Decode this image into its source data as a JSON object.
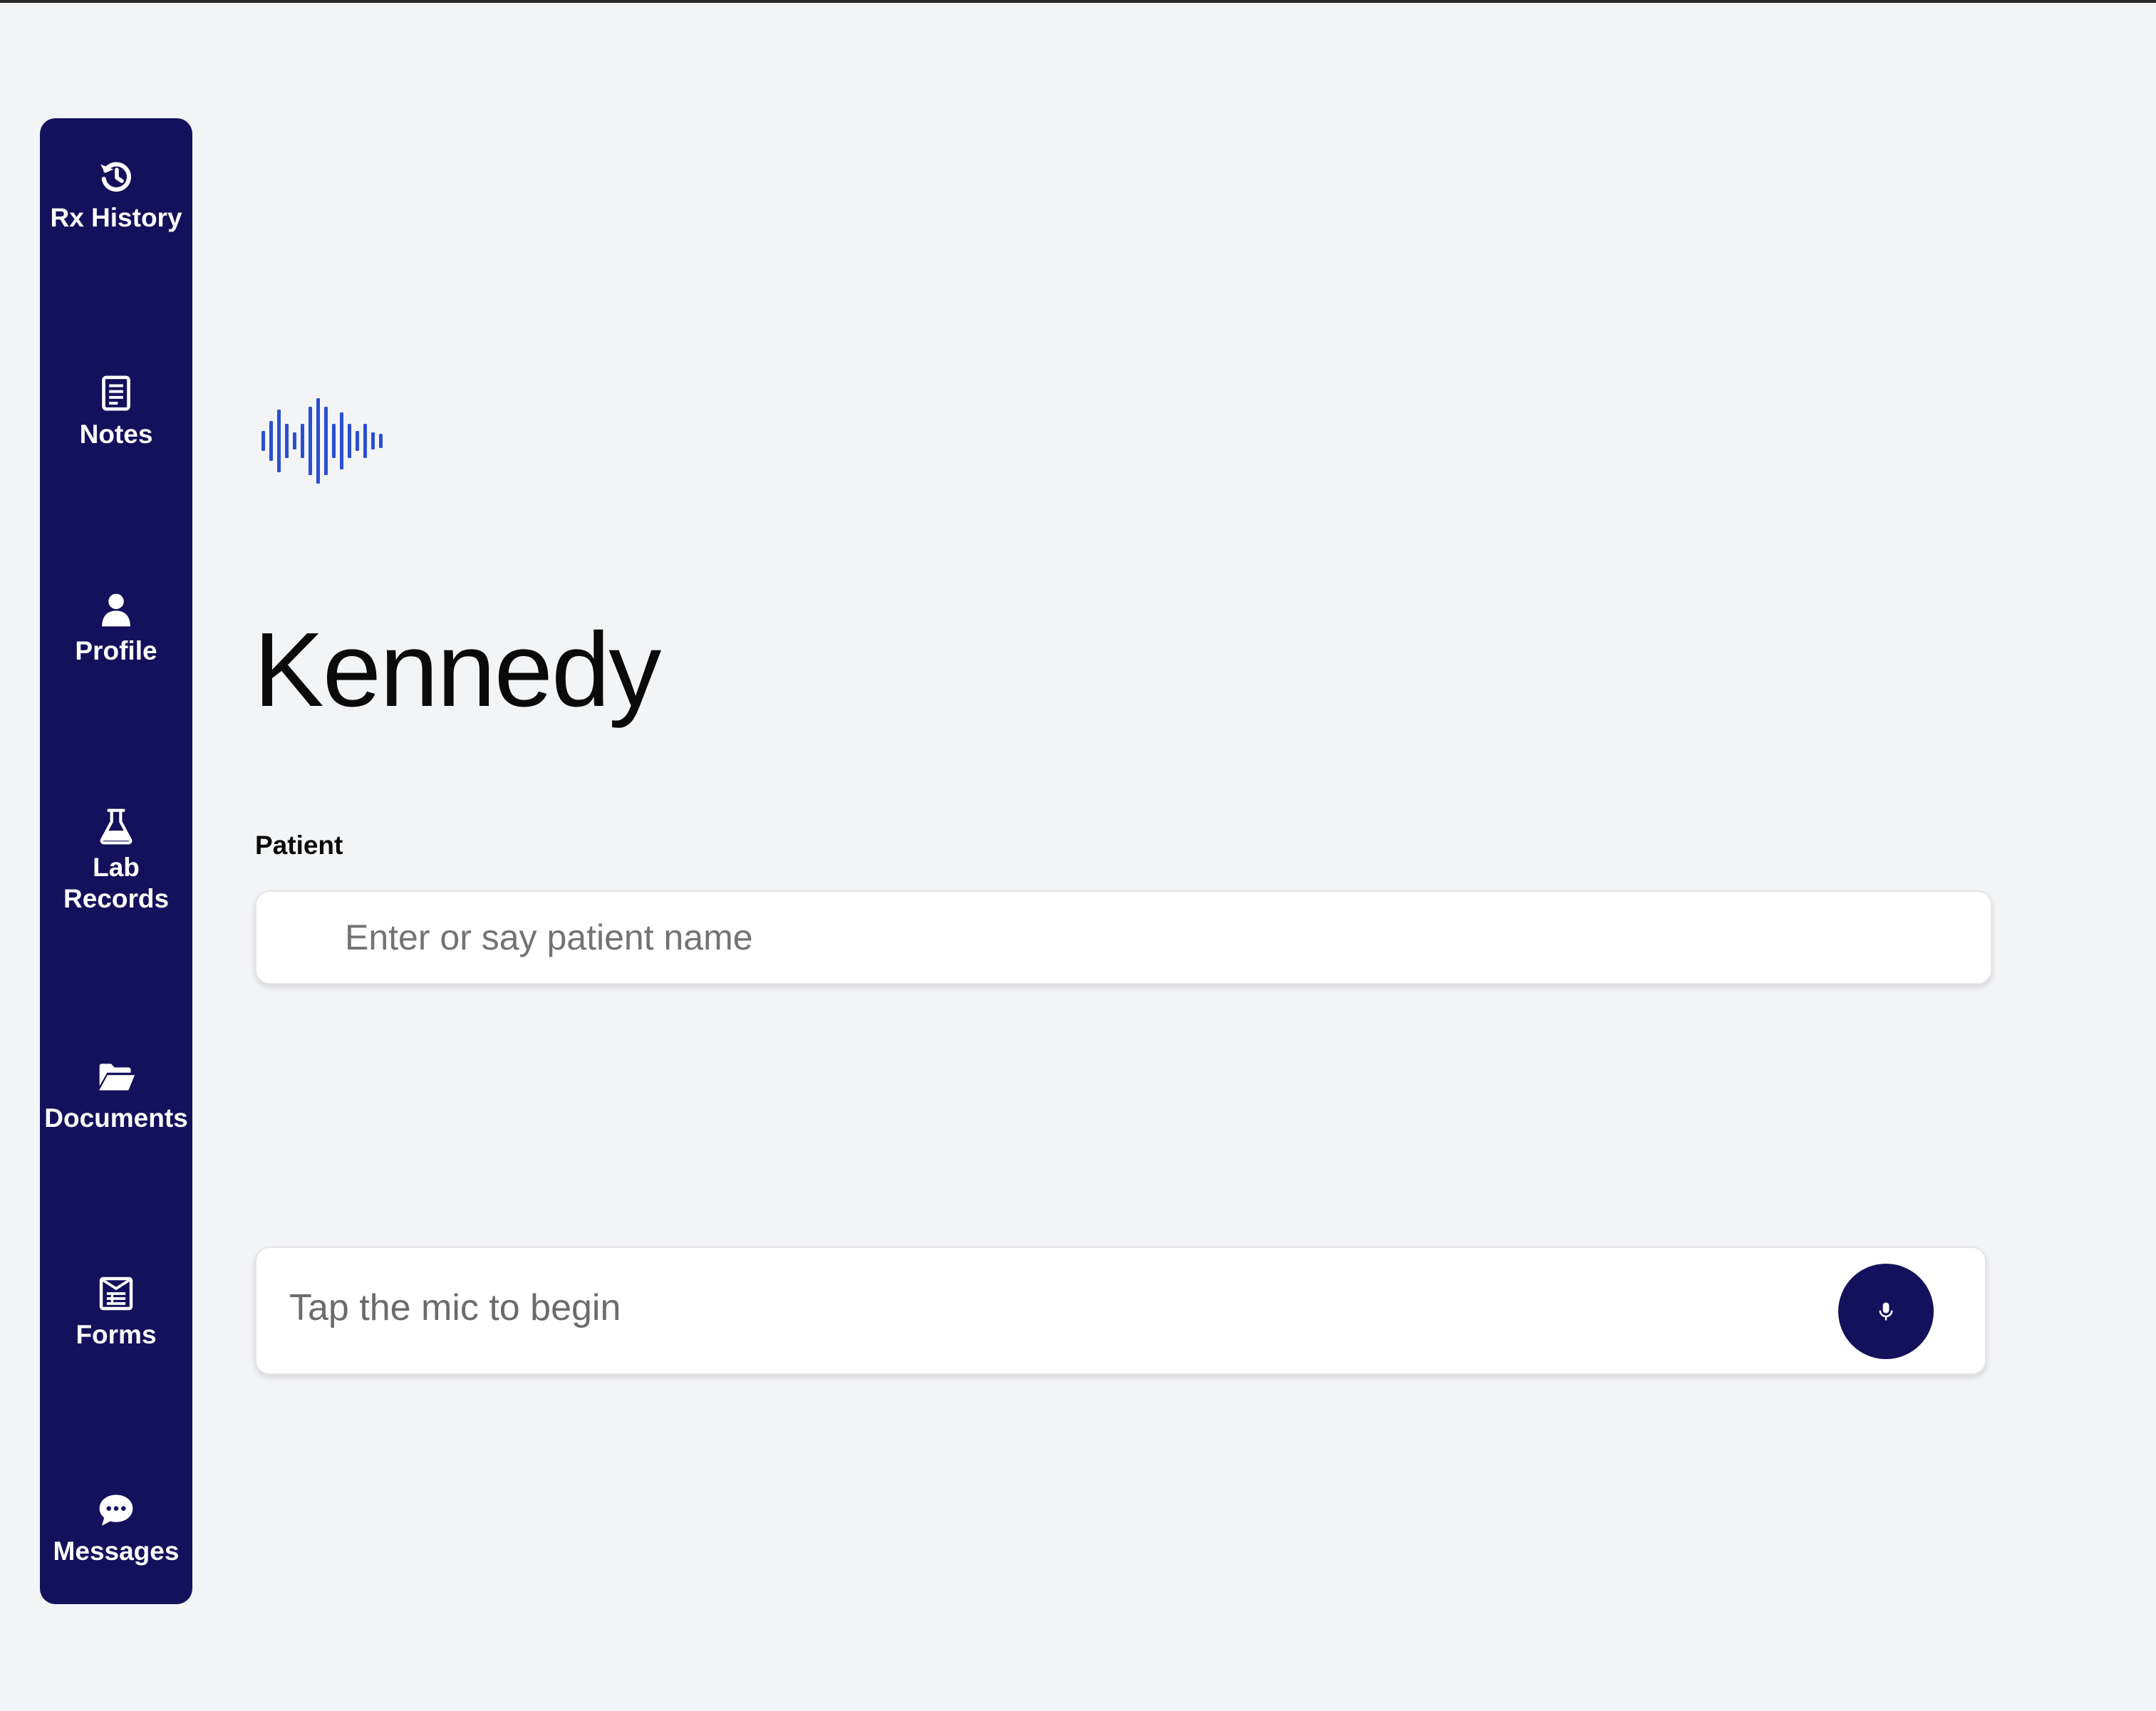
{
  "sidebar": {
    "items": [
      {
        "label": "Rx History",
        "icon": "history-icon"
      },
      {
        "label": "Notes",
        "icon": "notes-icon"
      },
      {
        "label": "Profile",
        "icon": "person-icon"
      },
      {
        "label": "Lab\nRecords",
        "icon": "flask-icon"
      },
      {
        "label": "Documents",
        "icon": "folder-open-icon"
      },
      {
        "label": "Forms",
        "icon": "form-icon"
      },
      {
        "label": "Messages",
        "icon": "chat-bubble-icon"
      }
    ]
  },
  "header": {
    "logo_icon": "sound-wave-icon",
    "title": "Kennedy"
  },
  "patient": {
    "label": "Patient",
    "placeholder": "Enter or say patient name",
    "value": ""
  },
  "dictation": {
    "prompt": "Tap the mic to begin",
    "mic_icon": "microphone-icon"
  },
  "colors": {
    "sidebar_bg": "#13115C",
    "accent_wave": "#2B4FD1",
    "page_bg": "#F3F4F6",
    "mic_button_bg": "#13115C"
  }
}
